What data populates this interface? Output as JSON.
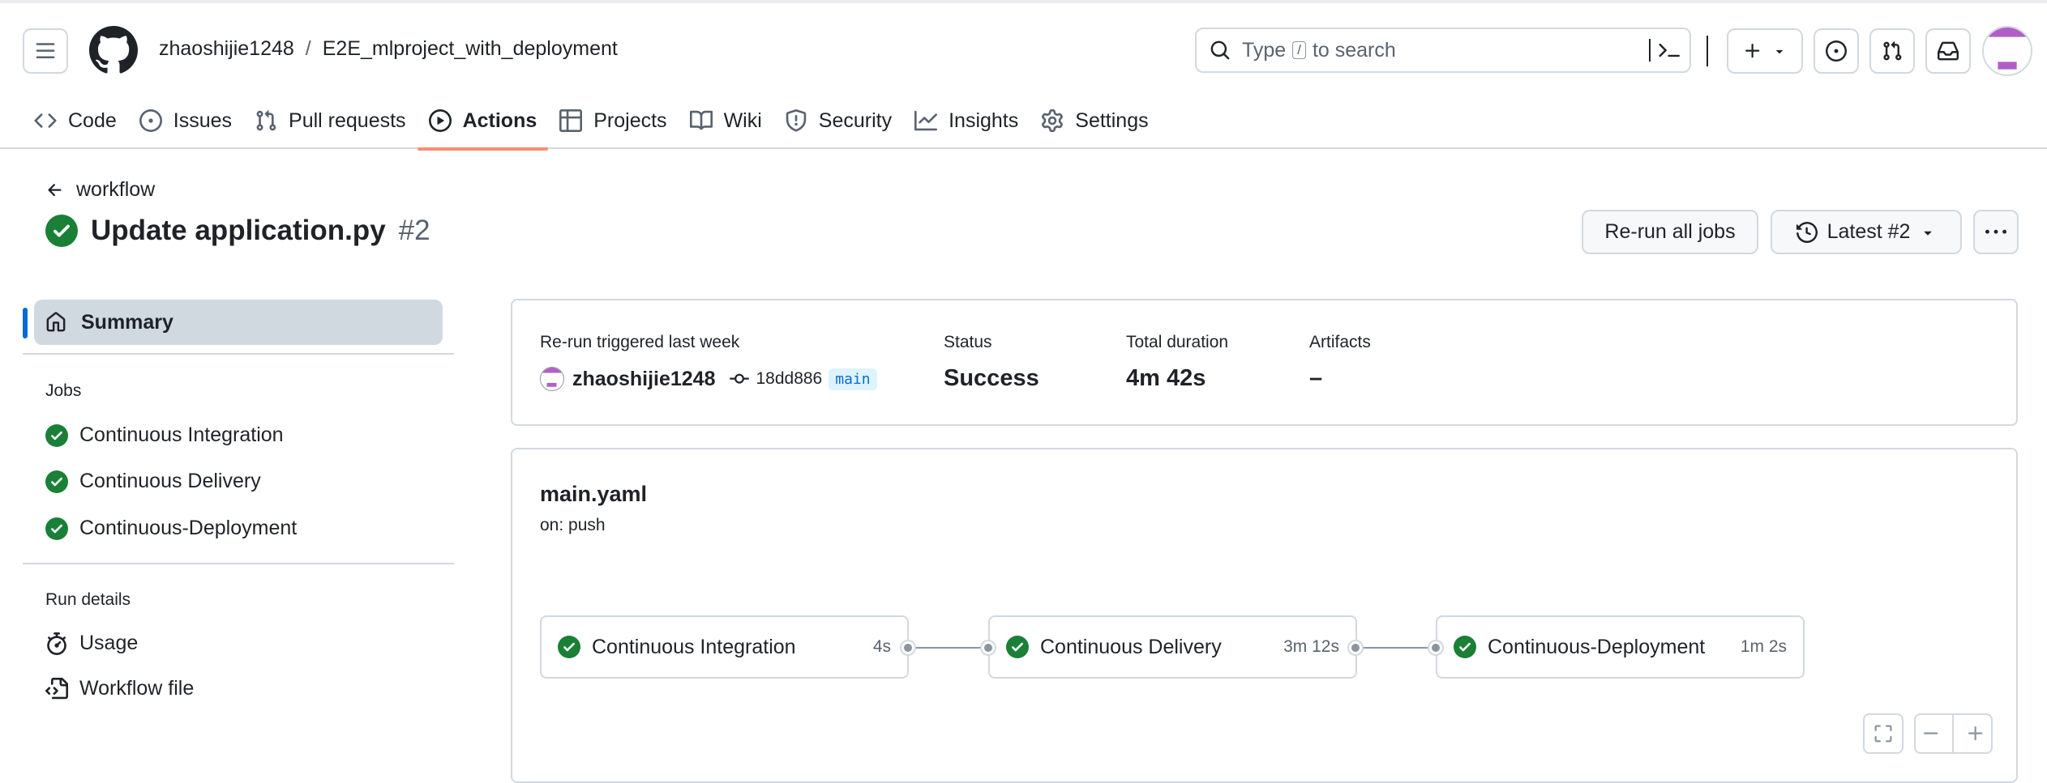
{
  "header": {
    "owner": "zhaoshijie1248",
    "separator": "/",
    "repo": "E2E_mlproject_with_deployment",
    "search_before": "Type",
    "search_key": "/",
    "search_after": "to search"
  },
  "tabs": [
    {
      "label": "Code",
      "icon": "code-icon"
    },
    {
      "label": "Issues",
      "icon": "issue-opened-icon"
    },
    {
      "label": "Pull requests",
      "icon": "git-pull-request-icon"
    },
    {
      "label": "Actions",
      "icon": "play-icon"
    },
    {
      "label": "Projects",
      "icon": "table-icon"
    },
    {
      "label": "Wiki",
      "icon": "book-icon"
    },
    {
      "label": "Security",
      "icon": "shield-icon"
    },
    {
      "label": "Insights",
      "icon": "graph-icon"
    },
    {
      "label": "Settings",
      "icon": "gear-icon"
    }
  ],
  "active_tab": "Actions",
  "page": {
    "back_label": "workflow",
    "title": "Update application.py",
    "run_number": "#2",
    "rerun_label": "Re-run all jobs",
    "latest_label": "Latest #2"
  },
  "sidebar": {
    "summary_label": "Summary",
    "jobs_heading": "Jobs",
    "jobs": [
      "Continuous Integration",
      "Continuous Delivery",
      "Continuous-Deployment"
    ],
    "run_details_heading": "Run details",
    "usage_label": "Usage",
    "workflow_file_label": "Workflow file"
  },
  "summary": {
    "trigger_label": "Re-run triggered last week",
    "actor": "zhaoshijie1248",
    "commit": "18dd886",
    "branch": "main",
    "status_label": "Status",
    "status_value": "Success",
    "duration_label": "Total duration",
    "duration_value": "4m 42s",
    "artifacts_label": "Artifacts",
    "artifacts_value": "–"
  },
  "workflow": {
    "file": "main.yaml",
    "trigger": "on: push",
    "jobs": [
      {
        "name": "Continuous Integration",
        "duration": "4s"
      },
      {
        "name": "Continuous Delivery",
        "duration": "3m 12s"
      },
      {
        "name": "Continuous-Deployment",
        "duration": "1m 2s"
      }
    ]
  },
  "colors": {
    "success": "#1a7f37",
    "active_tab_underline": "#fd8c73",
    "accent": "#0969da"
  }
}
